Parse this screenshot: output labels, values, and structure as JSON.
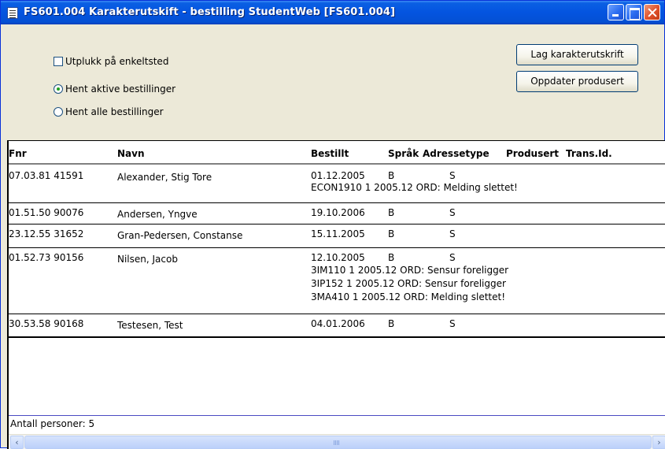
{
  "window": {
    "title": "FS601.004 Karakterutskift - bestilling StudentWeb [FS601.004]"
  },
  "options": {
    "utplukk_label": "Utplukk på enkeltsted",
    "utplukk_checked": false,
    "aktive_label": "Hent aktive bestillinger",
    "aktive_selected": true,
    "alle_label": "Hent alle bestillinger",
    "alle_selected": false
  },
  "buttons": {
    "lag_label": "Lag karakterutskrift",
    "oppdater_label": "Oppdater produsert"
  },
  "table": {
    "columns": {
      "fnr": "Fnr",
      "navn": "Navn",
      "bestillt": "Bestillt",
      "sprak": "Språk",
      "adressetype": "Adressetype",
      "produsert": "Produsert",
      "transid": "Trans.Id."
    },
    "rows": [
      {
        "fnr": "07.03.81 41591",
        "navn": "Alexander, Stig Tore",
        "bestillt": "01.12.2005",
        "sprak": "B",
        "adressetype": "S",
        "messages": [
          "ECON1910 1 2005.12 ORD: Melding slettet!"
        ]
      },
      {
        "fnr": "01.51.50 90076",
        "navn": "Andersen, Yngve",
        "bestillt": "19.10.2006",
        "sprak": "B",
        "adressetype": "S",
        "messages": []
      },
      {
        "fnr": "23.12.55 31652",
        "navn": "Gran-Pedersen, Constanse",
        "bestillt": "15.11.2005",
        "sprak": "B",
        "adressetype": "S",
        "messages": []
      },
      {
        "fnr": "01.52.73 90156",
        "navn": "Nilsen, Jacob",
        "bestillt": "12.10.2005",
        "sprak": "B",
        "adressetype": "S",
        "messages": [
          "3IM110 1 2005.12 ORD: Sensur foreligger",
          "3IP152 1 2005.12 ORD: Sensur foreligger",
          "3MA410 1 2005.12 ORD: Melding slettet!"
        ]
      },
      {
        "fnr": "30.53.58 90168",
        "navn": "Testesen, Test",
        "bestillt": "04.01.2006",
        "sprak": "B",
        "adressetype": "S",
        "messages": []
      }
    ]
  },
  "footer": {
    "count_text": "Antall personer: 5"
  },
  "colors": {
    "titlebar": "#0454e0",
    "window_bg": "#ece9d8",
    "radio_dot": "#21a121"
  }
}
